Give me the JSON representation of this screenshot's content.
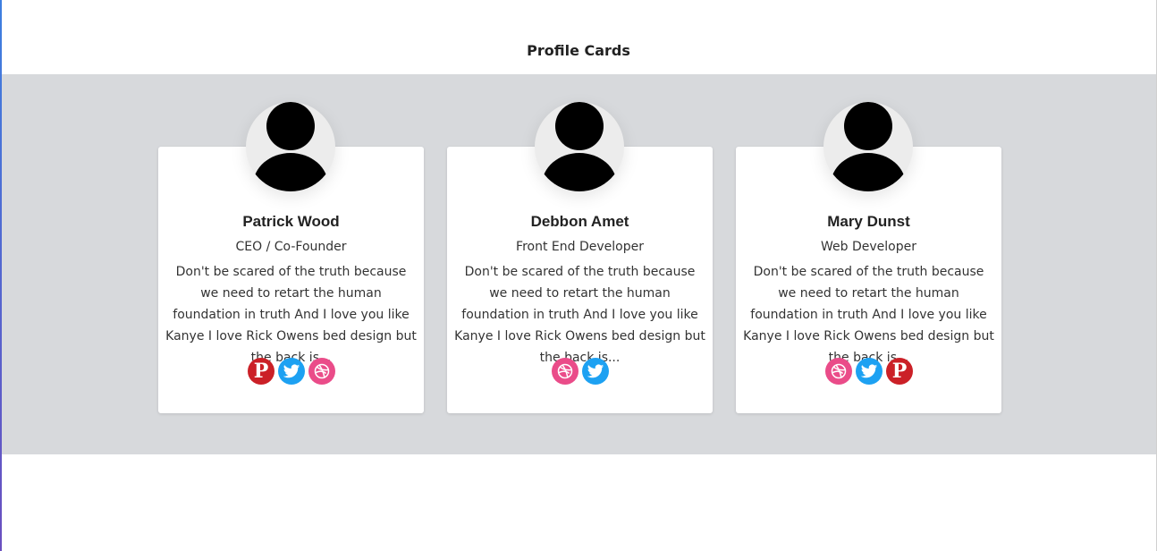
{
  "page": {
    "title": "Profile Cards"
  },
  "colors": {
    "pinterest": "#cb2027",
    "twitter": "#1da1f2",
    "dribbble": "#ea4c89",
    "band": "#d7d9dc"
  },
  "cards": [
    {
      "name": "Patrick Wood",
      "role": "CEO / Co-Founder",
      "bio": "Don't be scared of the truth because we need to retart the human foundation in truth And I love you like Kanye I love Rick Owens bed design but the back is...",
      "socials": [
        "pinterest-icon",
        "twitter-icon",
        "dribbble-icon"
      ]
    },
    {
      "name": "Debbon Amet",
      "role": "Front End Developer",
      "bio": "Don't be scared of the truth because we need to retart the human foundation in truth And I love you like Kanye I love Rick Owens bed design but the back is...",
      "socials": [
        "dribbble-icon",
        "twitter-icon"
      ]
    },
    {
      "name": "Mary Dunst",
      "role": "Web Developer",
      "bio": "Don't be scared of the truth because we need to retart the human foundation in truth And I love you like Kanye I love Rick Owens bed design but the back is...",
      "socials": [
        "dribbble-icon",
        "twitter-icon",
        "pinterest-icon"
      ]
    }
  ]
}
